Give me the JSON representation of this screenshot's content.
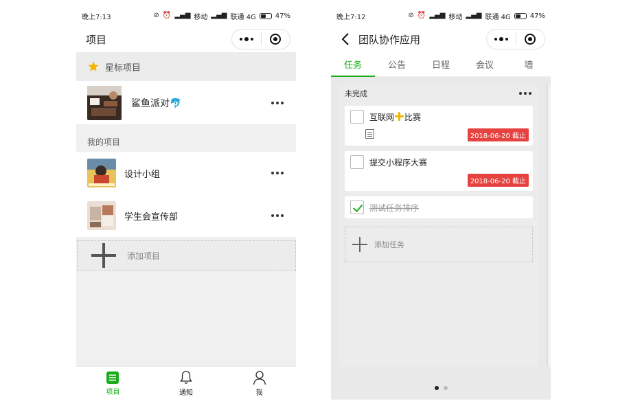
{
  "left": {
    "status": {
      "time": "晚上7:13",
      "carrier1": "移动",
      "carrier2": "联通 4G",
      "battery": "47%"
    },
    "nav": {
      "title": "项目"
    },
    "starred_section": {
      "title": "星标项目"
    },
    "starred_items": [
      {
        "name": "鲨鱼派对🐬"
      }
    ],
    "my_section": {
      "title": "我的项目"
    },
    "my_items": [
      {
        "name": "设计小组"
      },
      {
        "name": "学生会宣传部"
      }
    ],
    "add_project": {
      "label": "添加项目"
    },
    "tabbar": [
      {
        "label": "项目",
        "active": true,
        "icon": "list-icon"
      },
      {
        "label": "通知",
        "active": false,
        "icon": "bell-icon"
      },
      {
        "label": "我",
        "active": false,
        "icon": "person-icon"
      }
    ]
  },
  "right": {
    "status": {
      "time": "晚上7:12",
      "carrier1": "移动",
      "carrier2": "联通 4G",
      "battery": "47%"
    },
    "nav": {
      "title": "团队协作应用"
    },
    "tabs": [
      {
        "label": "任务",
        "active": true
      },
      {
        "label": "公告",
        "active": false
      },
      {
        "label": "日程",
        "active": false
      },
      {
        "label": "会议",
        "active": false
      },
      {
        "label": "墙",
        "active": false
      }
    ],
    "column": {
      "title": "未完成",
      "tasks": [
        {
          "title_prefix": "互联网",
          "title_suffix": "比赛",
          "due": "2018-06-20 截止",
          "done": false
        },
        {
          "title": "提交小程序大赛",
          "due": "2018-06-20 截止",
          "done": false
        },
        {
          "title": "测试任务排序",
          "done": true
        }
      ],
      "add_task_label": "添加任务"
    },
    "pager": {
      "count": 2,
      "current": 1
    }
  },
  "colors": {
    "accent": "#1aad19",
    "due_badge": "#e64340",
    "star": "#f2b600"
  }
}
